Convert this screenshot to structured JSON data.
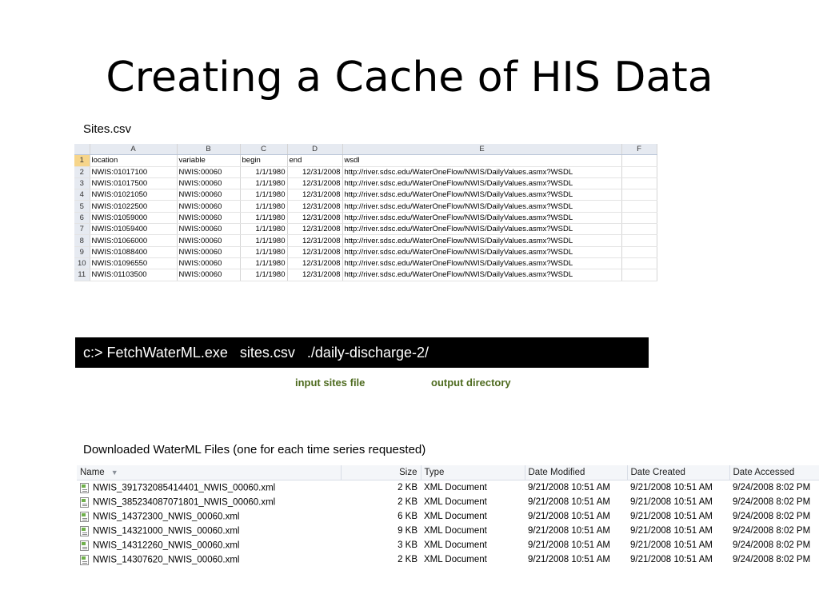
{
  "title": "Creating a Cache of HIS Data",
  "sites_label": "Sites.csv",
  "sheet": {
    "columns": [
      "A",
      "B",
      "C",
      "D",
      "E",
      "F"
    ],
    "rows": [
      {
        "n": "1",
        "location": "location",
        "variable": "variable",
        "begin": "begin",
        "end": "end",
        "wsdl": "wsdl"
      },
      {
        "n": "2",
        "location": "NWIS:01017100",
        "variable": "NWIS:00060",
        "begin": "1/1/1980",
        "end": "12/31/2008",
        "wsdl": "http://river.sdsc.edu/WaterOneFlow/NWIS/DailyValues.asmx?WSDL"
      },
      {
        "n": "3",
        "location": "NWIS:01017500",
        "variable": "NWIS:00060",
        "begin": "1/1/1980",
        "end": "12/31/2008",
        "wsdl": "http://river.sdsc.edu/WaterOneFlow/NWIS/DailyValues.asmx?WSDL"
      },
      {
        "n": "4",
        "location": "NWIS:01021050",
        "variable": "NWIS:00060",
        "begin": "1/1/1980",
        "end": "12/31/2008",
        "wsdl": "http://river.sdsc.edu/WaterOneFlow/NWIS/DailyValues.asmx?WSDL"
      },
      {
        "n": "5",
        "location": "NWIS:01022500",
        "variable": "NWIS:00060",
        "begin": "1/1/1980",
        "end": "12/31/2008",
        "wsdl": "http://river.sdsc.edu/WaterOneFlow/NWIS/DailyValues.asmx?WSDL"
      },
      {
        "n": "6",
        "location": "NWIS:01059000",
        "variable": "NWIS:00060",
        "begin": "1/1/1980",
        "end": "12/31/2008",
        "wsdl": "http://river.sdsc.edu/WaterOneFlow/NWIS/DailyValues.asmx?WSDL"
      },
      {
        "n": "7",
        "location": "NWIS:01059400",
        "variable": "NWIS:00060",
        "begin": "1/1/1980",
        "end": "12/31/2008",
        "wsdl": "http://river.sdsc.edu/WaterOneFlow/NWIS/DailyValues.asmx?WSDL"
      },
      {
        "n": "8",
        "location": "NWIS:01066000",
        "variable": "NWIS:00060",
        "begin": "1/1/1980",
        "end": "12/31/2008",
        "wsdl": "http://river.sdsc.edu/WaterOneFlow/NWIS/DailyValues.asmx?WSDL"
      },
      {
        "n": "9",
        "location": "NWIS:01088400",
        "variable": "NWIS:00060",
        "begin": "1/1/1980",
        "end": "12/31/2008",
        "wsdl": "http://river.sdsc.edu/WaterOneFlow/NWIS/DailyValues.asmx?WSDL"
      },
      {
        "n": "10",
        "location": "NWIS:01096550",
        "variable": "NWIS:00060",
        "begin": "1/1/1980",
        "end": "12/31/2008",
        "wsdl": "http://river.sdsc.edu/WaterOneFlow/NWIS/DailyValues.asmx?WSDL"
      },
      {
        "n": "11",
        "location": "NWIS:01103500",
        "variable": "NWIS:00060",
        "begin": "1/1/1980",
        "end": "12/31/2008",
        "wsdl": "http://river.sdsc.edu/WaterOneFlow/NWIS/DailyValues.asmx?WSDL"
      }
    ]
  },
  "command": "c:> FetchWaterML.exe   sites.csv   ./daily-discharge-2/",
  "annotations": {
    "input": "input sites file",
    "output": "output directory"
  },
  "downloads_label": "Downloaded WaterML Files (one for each time series requested)",
  "explorer": {
    "headers": {
      "name": "Name",
      "size": "Size",
      "type": "Type",
      "modified": "Date Modified",
      "created": "Date Created",
      "accessed": "Date Accessed"
    },
    "files": [
      {
        "name": "NWIS_391732085414401_NWIS_00060.xml",
        "size": "2 KB",
        "type": "XML Document",
        "modified": "9/21/2008 10:51 AM",
        "created": "9/21/2008 10:51 AM",
        "accessed": "9/24/2008 8:02 PM"
      },
      {
        "name": "NWIS_385234087071801_NWIS_00060.xml",
        "size": "2 KB",
        "type": "XML Document",
        "modified": "9/21/2008 10:51 AM",
        "created": "9/21/2008 10:51 AM",
        "accessed": "9/24/2008 8:02 PM"
      },
      {
        "name": "NWIS_14372300_NWIS_00060.xml",
        "size": "6 KB",
        "type": "XML Document",
        "modified": "9/21/2008 10:51 AM",
        "created": "9/21/2008 10:51 AM",
        "accessed": "9/24/2008 8:02 PM"
      },
      {
        "name": "NWIS_14321000_NWIS_00060.xml",
        "size": "9 KB",
        "type": "XML Document",
        "modified": "9/21/2008 10:51 AM",
        "created": "9/21/2008 10:51 AM",
        "accessed": "9/24/2008 8:02 PM"
      },
      {
        "name": "NWIS_14312260_NWIS_00060.xml",
        "size": "3 KB",
        "type": "XML Document",
        "modified": "9/21/2008 10:51 AM",
        "created": "9/21/2008 10:51 AM",
        "accessed": "9/24/2008 8:02 PM"
      },
      {
        "name": "NWIS_14307620_NWIS_00060.xml",
        "size": "2 KB",
        "type": "XML Document",
        "modified": "9/21/2008 10:51 AM",
        "created": "9/21/2008 10:51 AM",
        "accessed": "9/24/2008 8:02 PM"
      }
    ]
  }
}
